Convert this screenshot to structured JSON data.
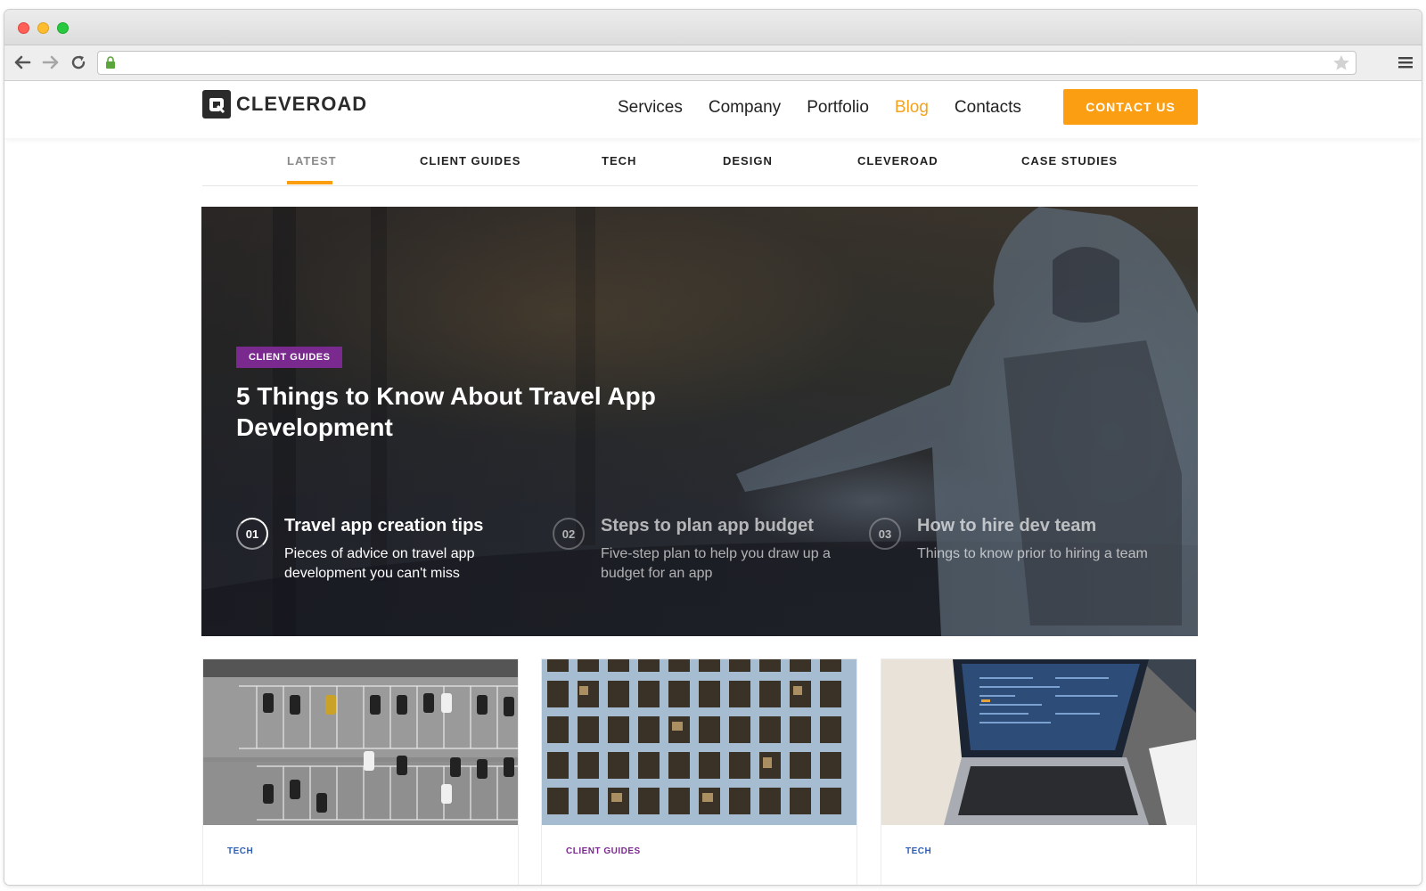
{
  "browser": {
    "url": ""
  },
  "site": {
    "logo_text": "CLEVEROAD",
    "nav": [
      {
        "label": "Services"
      },
      {
        "label": "Company"
      },
      {
        "label": "Portfolio"
      },
      {
        "label": "Blog",
        "active": true
      },
      {
        "label": "Contacts"
      }
    ],
    "contact_button": "CONTACT US",
    "colors": {
      "accent": "#fb9e12",
      "tag_client_guides": "#7a2a8e",
      "tag_tech": "#2d5fb5"
    }
  },
  "subnav": {
    "items": [
      {
        "label": "LATEST",
        "active": true
      },
      {
        "label": "CLIENT GUIDES"
      },
      {
        "label": "TECH"
      },
      {
        "label": "DESIGN"
      },
      {
        "label": "CLEVEROAD"
      },
      {
        "label": "CASE STUDIES"
      }
    ]
  },
  "hero": {
    "tag": "CLIENT GUIDES",
    "title": "5 Things to Know About Travel App Development",
    "steps": [
      {
        "num": "01",
        "title": "Travel app creation tips",
        "desc": "Pieces of advice on travel app development you can't miss"
      },
      {
        "num": "02",
        "title": "Steps to plan app budget",
        "desc": "Five-step plan to help you draw up a budget for an app"
      },
      {
        "num": "03",
        "title": "How to hire dev team",
        "desc": "Things to know prior to hiring a team"
      }
    ]
  },
  "cards": [
    {
      "tag": "TECH",
      "image": "parking-lot-photo"
    },
    {
      "tag": "CLIENT GUIDES",
      "image": "office-building-photo"
    },
    {
      "tag": "TECH",
      "image": "laptop-code-photo"
    }
  ]
}
